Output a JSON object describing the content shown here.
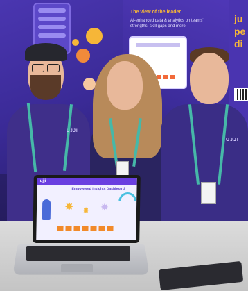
{
  "booth": {
    "wall_title": "The view of the leader",
    "wall_text": "AI-enhanced data & analytics on teams' strengths, skill gaps and more",
    "far_text": "ju\npe\ndi",
    "shirt_logo": "UJJI"
  },
  "laptop": {
    "app_logo": "ujji",
    "screen_title": "Empowered Insights Dashboard"
  },
  "colors": {
    "booth_purple": "#3b2b8c",
    "accent_orange": "#f26a3a",
    "accent_yellow": "#f6b638",
    "lanyard_teal": "#46b8a8"
  }
}
